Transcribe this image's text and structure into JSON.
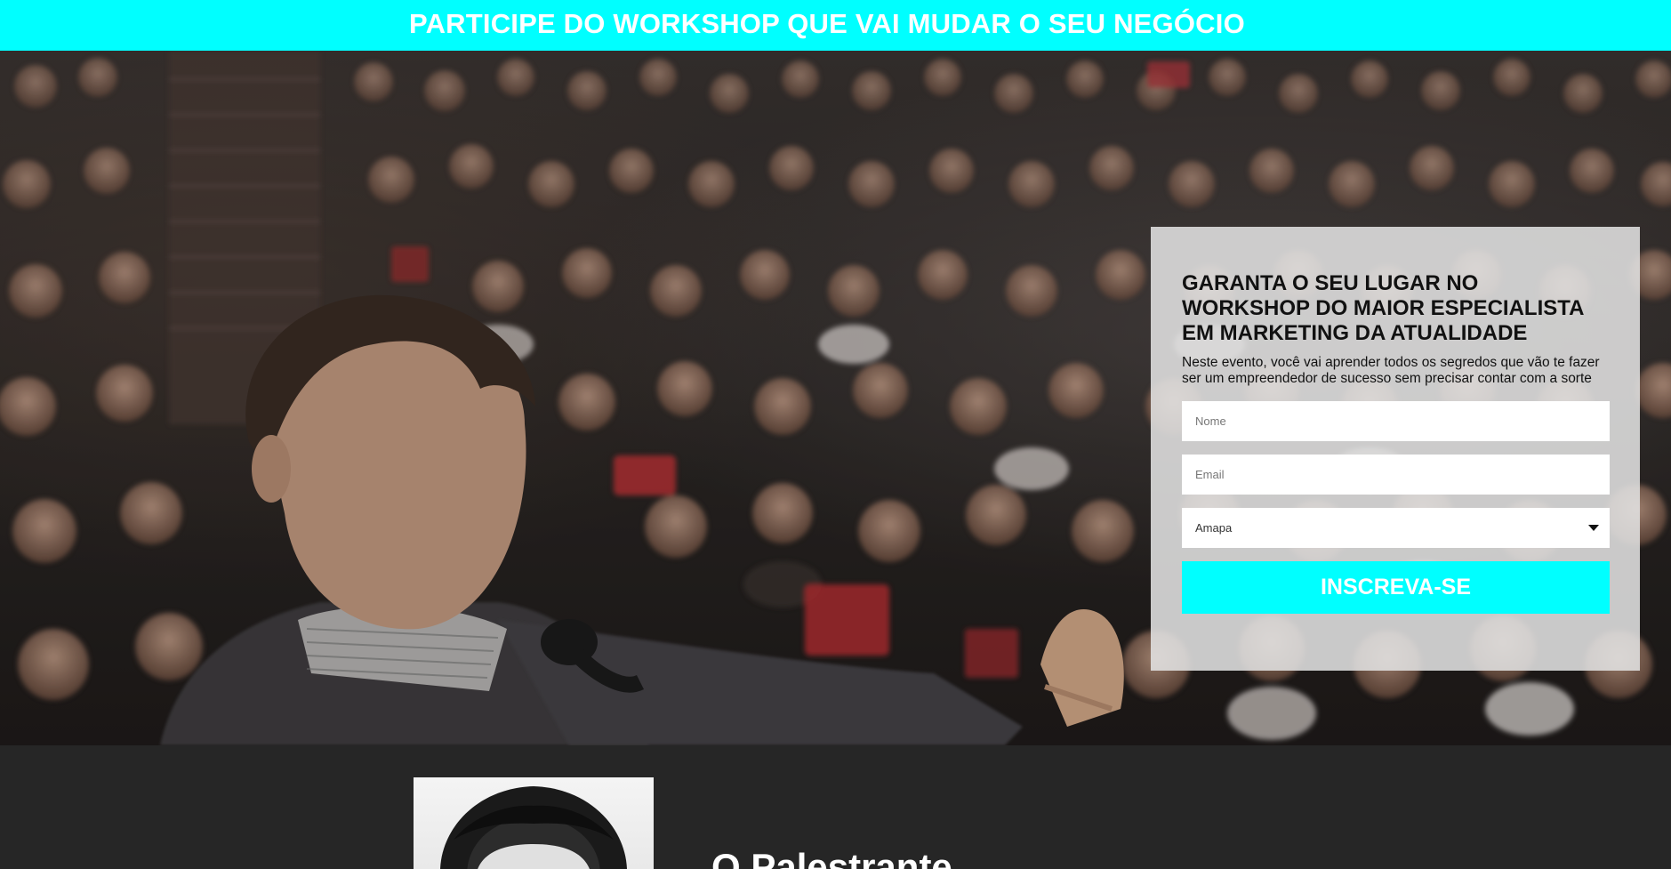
{
  "banner": {
    "headline": "PARTICIPE DO WORKSHOP QUE VAI MUDAR O SEU NEGÓCIO"
  },
  "hero": {
    "image": "conference-audience-speaker-photo"
  },
  "form": {
    "title": "GARANTA O SEU LUGAR NO WORKSHOP DO MAIOR ESPECIALISTA EM MARKETING DA ATUALIDADE",
    "description": "Neste evento, você vai aprender todos os segredos que vão te fazer ser um empreendedor de sucesso sem precisar contar com a sorte",
    "name_placeholder": "Nome",
    "email_placeholder": "Email",
    "state_selected": "Amapa",
    "submit_label": "INSCREVA-SE"
  },
  "speaker_section": {
    "heading": "O Palestrante"
  },
  "colors": {
    "accent": "#00ffff",
    "dark_bg": "#262626",
    "card_bg": "#e1e1e1"
  }
}
